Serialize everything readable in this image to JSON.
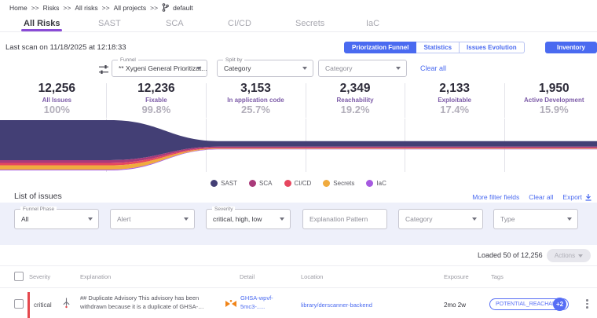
{
  "breadcrumb": {
    "separator": ">>",
    "items": [
      "Home",
      "Risks",
      "All risks",
      "All projects"
    ],
    "current": "default"
  },
  "tabs": {
    "items": [
      {
        "label": "All Risks"
      },
      {
        "label": "SAST"
      },
      {
        "label": "SCA"
      },
      {
        "label": "CI/CD"
      },
      {
        "label": "Secrets"
      },
      {
        "label": "IaC"
      }
    ]
  },
  "toolbar": {
    "last_scan": "Last scan on 11/18/2025 at 12:18:33",
    "views": [
      {
        "label": "Priorization Funnel"
      },
      {
        "label": "Statistics"
      },
      {
        "label": "Issues Evolution"
      }
    ],
    "inventory_label": "Inventory Assets"
  },
  "controls": {
    "funnel_label": "Funnel",
    "funnel_value": "** Xygeni General Prioritizat...",
    "split_label": "Split by",
    "split_value": "Category",
    "category_placeholder": "Category",
    "clear_all_label": "Clear all"
  },
  "chart_data": {
    "type": "area",
    "title": "Priorization Funnel",
    "stages": [
      {
        "count": "12,256",
        "value": 12256,
        "label": "All Issues",
        "percent": "100%"
      },
      {
        "count": "12,236",
        "value": 12236,
        "label": "Fixable",
        "percent": "99.8%"
      },
      {
        "count": "3,153",
        "value": 3153,
        "label": "In application code",
        "percent": "25.7%"
      },
      {
        "count": "2,349",
        "value": 2349,
        "label": "Reachability",
        "percent": "19.2%"
      },
      {
        "count": "2,133",
        "value": 2133,
        "label": "Exploitable",
        "percent": "17.4%"
      },
      {
        "count": "1,950",
        "value": 1950,
        "label": "Active Development",
        "percent": "15.9%"
      }
    ],
    "series": [
      {
        "name": "SAST",
        "color": "#433f75"
      },
      {
        "name": "SCA",
        "color": "#a93a7a"
      },
      {
        "name": "CI/CD",
        "color": "#e6475f"
      },
      {
        "name": "Secrets",
        "color": "#f0ab3f"
      },
      {
        "name": "IaC",
        "color": "#a65ae0"
      }
    ],
    "legend_position": "bottom",
    "grid": true
  },
  "issues": {
    "title": "List of issues",
    "more_filters_label": "More filter fields",
    "clear_all_label": "Clear all",
    "export_label": "Export",
    "loaded_text": "Loaded 50 of 12,256",
    "actions_label": "Actions"
  },
  "filters": [
    {
      "label": "Funnel Phase",
      "value": "All"
    },
    {
      "label": "",
      "value": "Alert"
    },
    {
      "label": "Severity",
      "value": "critical, high, low"
    },
    {
      "label": "",
      "value": "Explanation Pattern"
    },
    {
      "label": "",
      "value": "Category"
    },
    {
      "label": "",
      "value": "Type"
    }
  ],
  "table": {
    "headers": [
      "Severity",
      "Explanation",
      "Detail",
      "Location",
      "Exposure",
      "Tags"
    ],
    "row": {
      "severity": "critical",
      "explanation": "## Duplicate Advisory This advisory has been withdrawn because it is a duplicate of GHSA-6q3q-...",
      "detail": "GHSA-wpvf-5mc3-.....",
      "location": "library/derscanner-backend",
      "exposure": "2mo 2w",
      "tag": "POTENTIAL_REACHABLE",
      "tag_more": "+2"
    }
  },
  "colors": {
    "accent_blue": "#4a6af0",
    "tab_purple": "#8a4bd6",
    "critical_red": "#e5484d",
    "panel_lavender": "#eef0fa"
  }
}
